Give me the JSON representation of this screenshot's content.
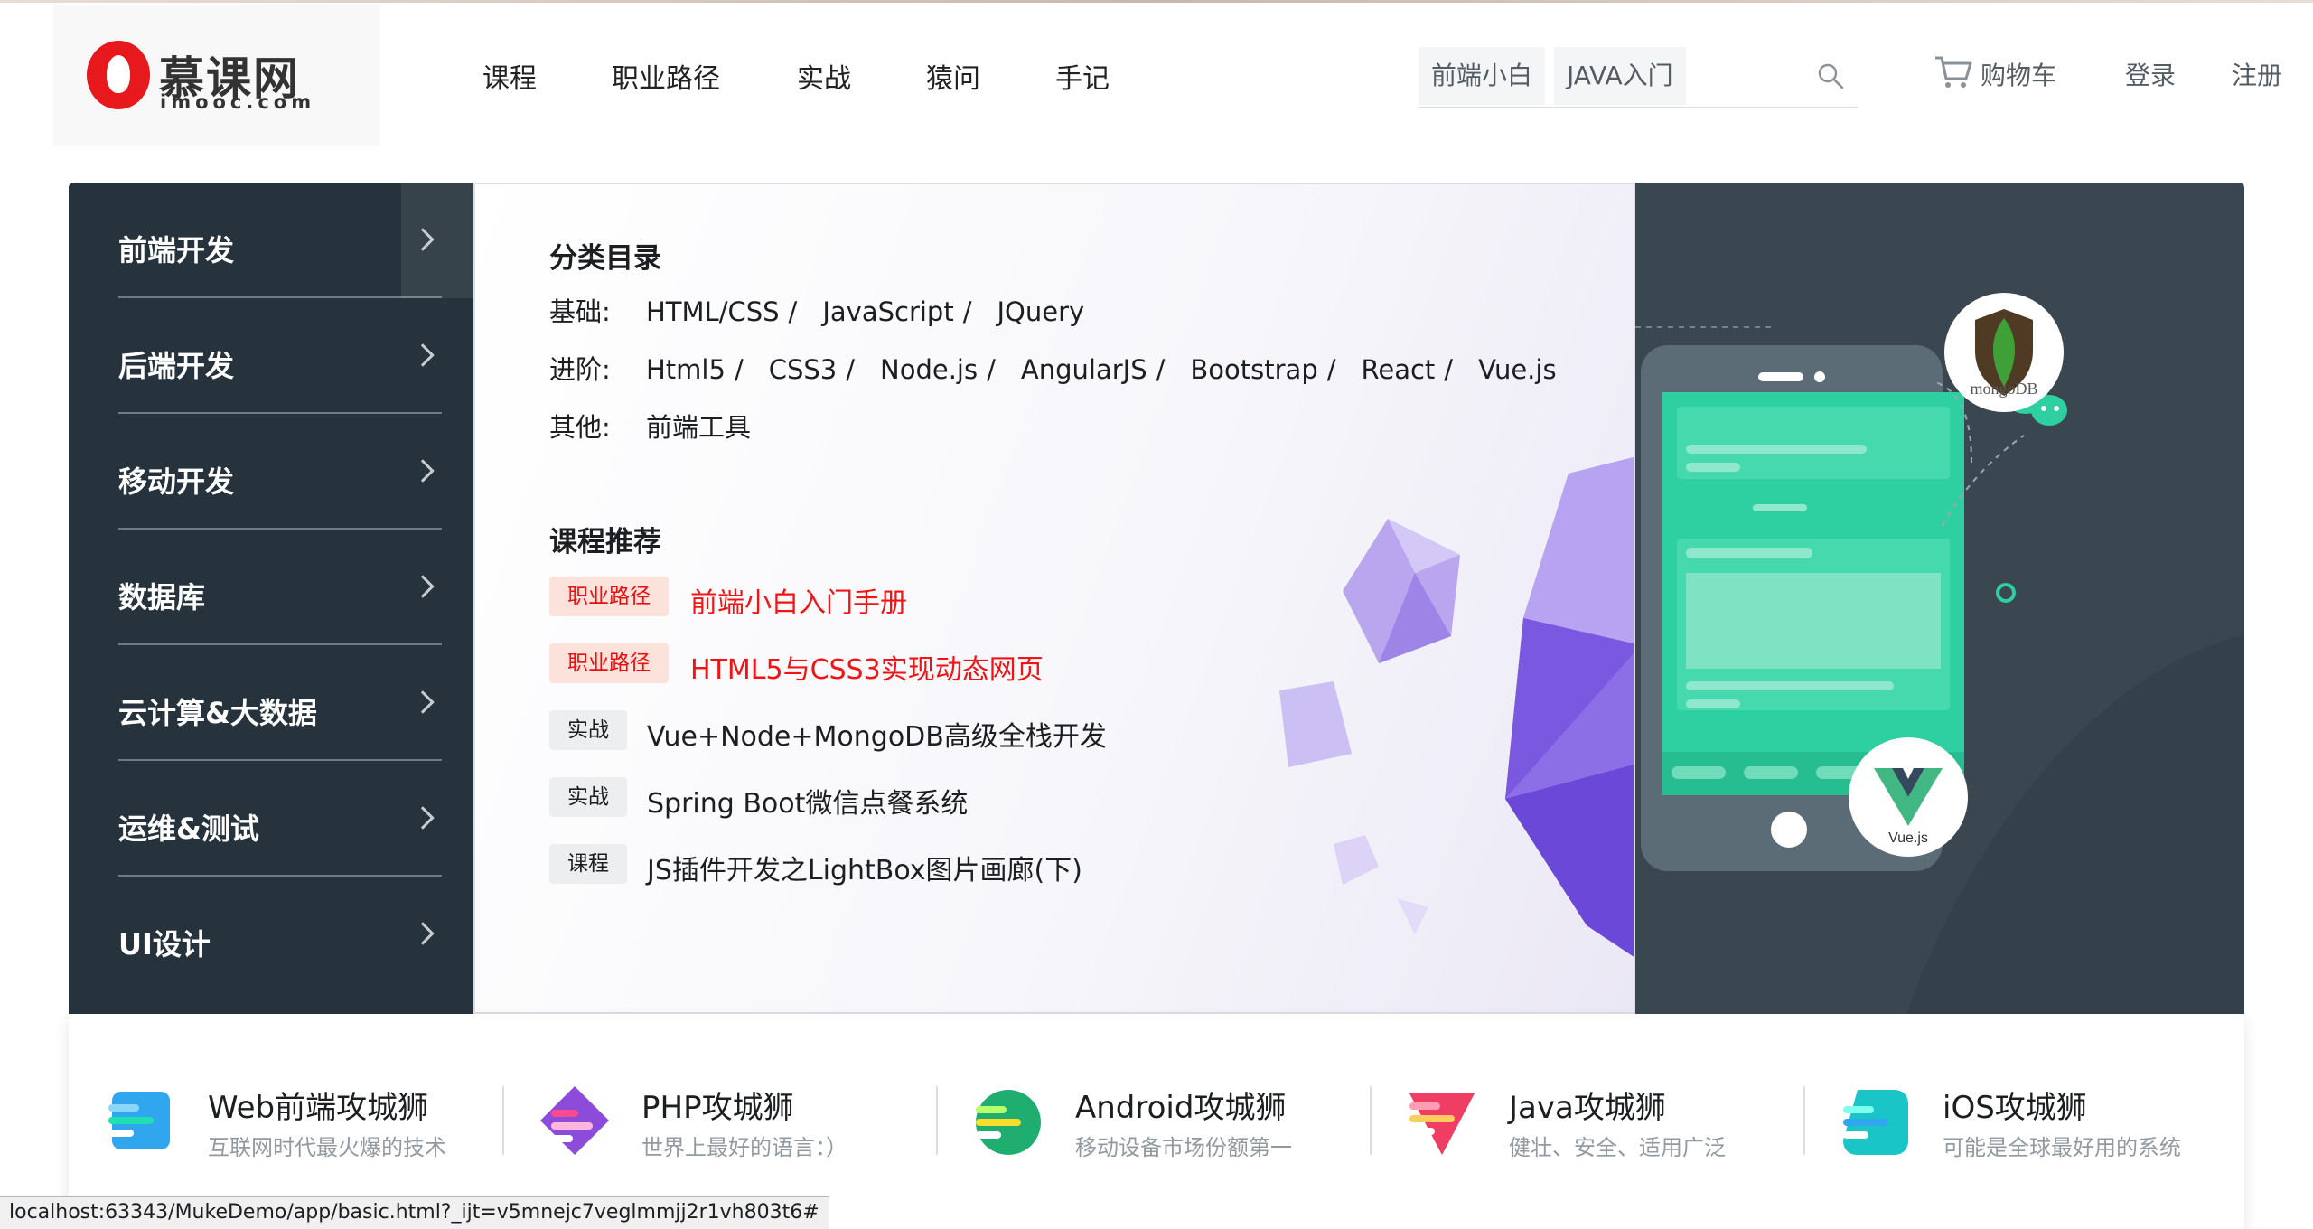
{
  "logo": {
    "cn": "慕课网",
    "en": "imooc.com"
  },
  "nav": [
    "课程",
    "职业路径",
    "实战",
    "猿问",
    "手记"
  ],
  "search": {
    "tags": [
      "前端小白",
      "JAVA入门"
    ]
  },
  "header_right": {
    "cart": "购物车",
    "login": "登录",
    "register": "注册"
  },
  "menu": [
    "前端开发",
    "后端开发",
    "移动开发",
    "数据库",
    "云计算&大数据",
    "运维&测试",
    "UI设计"
  ],
  "panel": {
    "catalog_title": "分类目录",
    "rows": [
      {
        "label": "基础:",
        "items": [
          "HTML/CSS",
          "JavaScript",
          "JQuery"
        ]
      },
      {
        "label": "进阶:",
        "items": [
          "Html5",
          "CSS3",
          "Node.js",
          "AngularJS",
          "Bootstrap",
          "React",
          "Vue.js"
        ]
      },
      {
        "label": "其他:",
        "items": [
          "前端工具"
        ]
      }
    ],
    "rec_title": "课程推荐",
    "recs": [
      {
        "tag": "职业路径",
        "title": "前端小白入门手册"
      },
      {
        "tag": "职业路径",
        "title": "HTML5与CSS3实现动态网页"
      },
      {
        "tag": "实战",
        "title": "Vue+Node+MongoDB高级全栈开发"
      },
      {
        "tag": "实战",
        "title": "Spring Boot微信点餐系统"
      },
      {
        "tag": "课程",
        "title": "JS插件开发之LightBox图片画廊(下)"
      }
    ]
  },
  "art": {
    "mongo": "mongoDB",
    "vue": "Vue.js"
  },
  "categories": [
    {
      "title": "Web前端攻城狮",
      "sub": "互联网时代最火爆的技术",
      "icon": "web-icon",
      "color": "#2fa6ee"
    },
    {
      "title": "PHP攻城狮",
      "sub": "世界上最好的语言：）",
      "icon": "php-icon",
      "color": "#8c4cd9"
    },
    {
      "title": "Android攻城狮",
      "sub": "移动设备市场份额第一",
      "icon": "android-icon",
      "color": "#1fae6f"
    },
    {
      "title": "Java攻城狮",
      "sub": "健壮、安全、适用广泛",
      "icon": "java-icon",
      "color": "#ef3d63"
    },
    {
      "title": "iOS攻城狮",
      "sub": "可能是全球最好用的系统",
      "icon": "ios-icon",
      "color": "#19c5c6"
    }
  ],
  "status_url": "localhost:63343/MukeDemo/app/basic.html?_ijt=v5mnejc7veglmmjj2r1vh803t6#"
}
